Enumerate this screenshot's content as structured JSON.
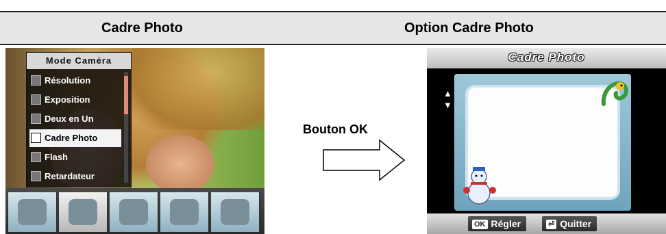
{
  "header": {
    "left_title": "Cadre Photo",
    "right_title": "Option Cadre Photo"
  },
  "left_screen": {
    "menu_title": "Mode Caméra",
    "menu_items": [
      {
        "label": "Résolution",
        "icon": "resolution-icon",
        "selected": false
      },
      {
        "label": "Exposition",
        "icon": "exposure-icon",
        "selected": false
      },
      {
        "label": "Deux en Un",
        "icon": "two-in-one-icon",
        "selected": false
      },
      {
        "label": "Cadre Photo",
        "icon": "photo-frame-icon",
        "selected": true
      },
      {
        "label": "Flash",
        "icon": "flash-icon",
        "selected": false
      },
      {
        "label": "Retardateur",
        "icon": "self-timer-icon",
        "selected": false
      }
    ],
    "mode_icons": [
      "film-reel-icon",
      "camera-icon",
      "microphone-icon",
      "palette-icon",
      "tools-icon"
    ],
    "active_mode": "camera-icon"
  },
  "arrow": {
    "label": "Bouton OK"
  },
  "right_screen": {
    "title": "Cadre Photo",
    "ok_key": "OK",
    "ok_label": "Régler",
    "quit_key": "⏎",
    "quit_label": "Quitter"
  },
  "colors": {
    "header_bg": "#e6e6e6",
    "menu_bg": "#0a0a0a",
    "selected_item_bg": "#f4f4f4",
    "frame_blue": "#6fa3bd"
  }
}
